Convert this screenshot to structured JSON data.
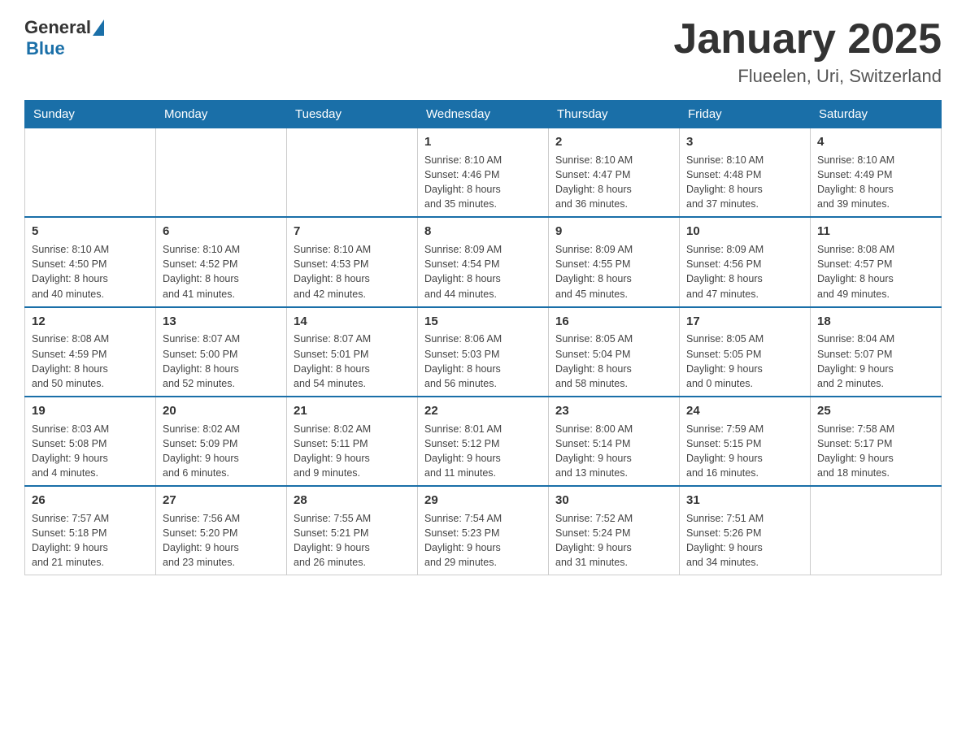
{
  "header": {
    "logo_general": "General",
    "logo_blue": "Blue",
    "title": "January 2025",
    "subtitle": "Flueelen, Uri, Switzerland"
  },
  "days_of_week": [
    "Sunday",
    "Monday",
    "Tuesday",
    "Wednesday",
    "Thursday",
    "Friday",
    "Saturday"
  ],
  "weeks": [
    [
      {
        "day": "",
        "info": ""
      },
      {
        "day": "",
        "info": ""
      },
      {
        "day": "",
        "info": ""
      },
      {
        "day": "1",
        "info": "Sunrise: 8:10 AM\nSunset: 4:46 PM\nDaylight: 8 hours\nand 35 minutes."
      },
      {
        "day": "2",
        "info": "Sunrise: 8:10 AM\nSunset: 4:47 PM\nDaylight: 8 hours\nand 36 minutes."
      },
      {
        "day": "3",
        "info": "Sunrise: 8:10 AM\nSunset: 4:48 PM\nDaylight: 8 hours\nand 37 minutes."
      },
      {
        "day": "4",
        "info": "Sunrise: 8:10 AM\nSunset: 4:49 PM\nDaylight: 8 hours\nand 39 minutes."
      }
    ],
    [
      {
        "day": "5",
        "info": "Sunrise: 8:10 AM\nSunset: 4:50 PM\nDaylight: 8 hours\nand 40 minutes."
      },
      {
        "day": "6",
        "info": "Sunrise: 8:10 AM\nSunset: 4:52 PM\nDaylight: 8 hours\nand 41 minutes."
      },
      {
        "day": "7",
        "info": "Sunrise: 8:10 AM\nSunset: 4:53 PM\nDaylight: 8 hours\nand 42 minutes."
      },
      {
        "day": "8",
        "info": "Sunrise: 8:09 AM\nSunset: 4:54 PM\nDaylight: 8 hours\nand 44 minutes."
      },
      {
        "day": "9",
        "info": "Sunrise: 8:09 AM\nSunset: 4:55 PM\nDaylight: 8 hours\nand 45 minutes."
      },
      {
        "day": "10",
        "info": "Sunrise: 8:09 AM\nSunset: 4:56 PM\nDaylight: 8 hours\nand 47 minutes."
      },
      {
        "day": "11",
        "info": "Sunrise: 8:08 AM\nSunset: 4:57 PM\nDaylight: 8 hours\nand 49 minutes."
      }
    ],
    [
      {
        "day": "12",
        "info": "Sunrise: 8:08 AM\nSunset: 4:59 PM\nDaylight: 8 hours\nand 50 minutes."
      },
      {
        "day": "13",
        "info": "Sunrise: 8:07 AM\nSunset: 5:00 PM\nDaylight: 8 hours\nand 52 minutes."
      },
      {
        "day": "14",
        "info": "Sunrise: 8:07 AM\nSunset: 5:01 PM\nDaylight: 8 hours\nand 54 minutes."
      },
      {
        "day": "15",
        "info": "Sunrise: 8:06 AM\nSunset: 5:03 PM\nDaylight: 8 hours\nand 56 minutes."
      },
      {
        "day": "16",
        "info": "Sunrise: 8:05 AM\nSunset: 5:04 PM\nDaylight: 8 hours\nand 58 minutes."
      },
      {
        "day": "17",
        "info": "Sunrise: 8:05 AM\nSunset: 5:05 PM\nDaylight: 9 hours\nand 0 minutes."
      },
      {
        "day": "18",
        "info": "Sunrise: 8:04 AM\nSunset: 5:07 PM\nDaylight: 9 hours\nand 2 minutes."
      }
    ],
    [
      {
        "day": "19",
        "info": "Sunrise: 8:03 AM\nSunset: 5:08 PM\nDaylight: 9 hours\nand 4 minutes."
      },
      {
        "day": "20",
        "info": "Sunrise: 8:02 AM\nSunset: 5:09 PM\nDaylight: 9 hours\nand 6 minutes."
      },
      {
        "day": "21",
        "info": "Sunrise: 8:02 AM\nSunset: 5:11 PM\nDaylight: 9 hours\nand 9 minutes."
      },
      {
        "day": "22",
        "info": "Sunrise: 8:01 AM\nSunset: 5:12 PM\nDaylight: 9 hours\nand 11 minutes."
      },
      {
        "day": "23",
        "info": "Sunrise: 8:00 AM\nSunset: 5:14 PM\nDaylight: 9 hours\nand 13 minutes."
      },
      {
        "day": "24",
        "info": "Sunrise: 7:59 AM\nSunset: 5:15 PM\nDaylight: 9 hours\nand 16 minutes."
      },
      {
        "day": "25",
        "info": "Sunrise: 7:58 AM\nSunset: 5:17 PM\nDaylight: 9 hours\nand 18 minutes."
      }
    ],
    [
      {
        "day": "26",
        "info": "Sunrise: 7:57 AM\nSunset: 5:18 PM\nDaylight: 9 hours\nand 21 minutes."
      },
      {
        "day": "27",
        "info": "Sunrise: 7:56 AM\nSunset: 5:20 PM\nDaylight: 9 hours\nand 23 minutes."
      },
      {
        "day": "28",
        "info": "Sunrise: 7:55 AM\nSunset: 5:21 PM\nDaylight: 9 hours\nand 26 minutes."
      },
      {
        "day": "29",
        "info": "Sunrise: 7:54 AM\nSunset: 5:23 PM\nDaylight: 9 hours\nand 29 minutes."
      },
      {
        "day": "30",
        "info": "Sunrise: 7:52 AM\nSunset: 5:24 PM\nDaylight: 9 hours\nand 31 minutes."
      },
      {
        "day": "31",
        "info": "Sunrise: 7:51 AM\nSunset: 5:26 PM\nDaylight: 9 hours\nand 34 minutes."
      },
      {
        "day": "",
        "info": ""
      }
    ]
  ]
}
